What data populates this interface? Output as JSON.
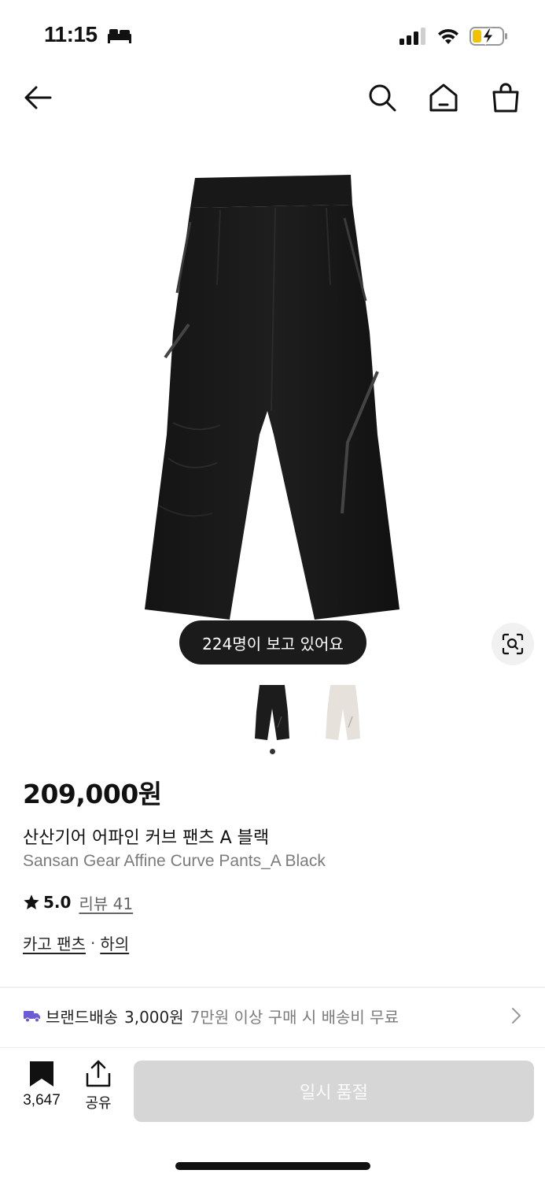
{
  "status_bar": {
    "time": "11:15"
  },
  "product": {
    "viewing_badge": "224명이 보고 있어요",
    "price": "209,000원",
    "name_ko": "산산기어 어파인 커브 팬츠 A 블랙",
    "name_en": "Sansan Gear Affine Curve Pants_A Black",
    "rating": "5.0",
    "review_label": "리뷰 41",
    "categories": [
      "카고 팬츠",
      "하의"
    ],
    "category_separator": "·",
    "thumbnails": [
      {
        "color_name": "black",
        "color": "#1c1c1c"
      },
      {
        "color_name": "ivory",
        "color": "#e6e2db"
      }
    ]
  },
  "shipping": {
    "label": "브랜드배송",
    "fee": "3,000원",
    "note": "7만원 이상 구매 시 배송비 무료"
  },
  "actions": {
    "bookmark_count": "3,647",
    "share_label": "공유",
    "soldout_label": "일시 품절"
  },
  "icons": {
    "back": "arrow-left-icon",
    "search": "search-icon",
    "home": "home-icon",
    "cart": "shopping-bag-icon",
    "lens": "image-search-icon",
    "star": "star-icon",
    "truck": "truck-icon",
    "bookmark": "bookmark-icon",
    "share": "share-icon"
  },
  "colors": {
    "accent_truck": "#6b5bd6",
    "soldout_bg": "#d6d6d6",
    "badge_bg": "#1b1b1b"
  }
}
